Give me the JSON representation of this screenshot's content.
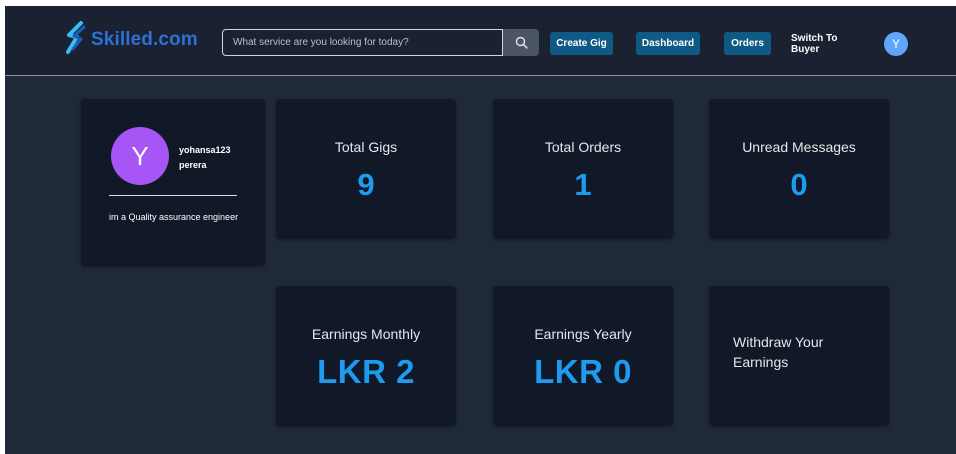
{
  "app": {
    "brand": "Skilled.com",
    "accent_color": "#0f5a85",
    "value_color": "#1d9bf0"
  },
  "nav": {
    "search_placeholder": "What service are you looking for today?",
    "search_icon": "search-icon",
    "create_gig": "Create Gig",
    "dashboard": "Dashboard",
    "orders": "Orders",
    "switch": "Switch To Buyer",
    "avatar_initial": "Y"
  },
  "profile": {
    "avatar_initial": "Y",
    "name_line1": "yohansa123",
    "name_line2": "perera",
    "bio": "im a Quality assurance engineer"
  },
  "stats": {
    "total_gigs_label": "Total Gigs",
    "total_gigs_value": "9",
    "total_orders_label": "Total Orders",
    "total_orders_value": "1",
    "unread_label": "Unread Messages",
    "unread_value": "0"
  },
  "earnings": {
    "monthly_label": "Earnings Monthly",
    "monthly_value": "LKR 2",
    "yearly_label": "Earnings Yearly",
    "yearly_value": "LKR 0",
    "withdraw_label": "Withdraw Your Earnings"
  }
}
